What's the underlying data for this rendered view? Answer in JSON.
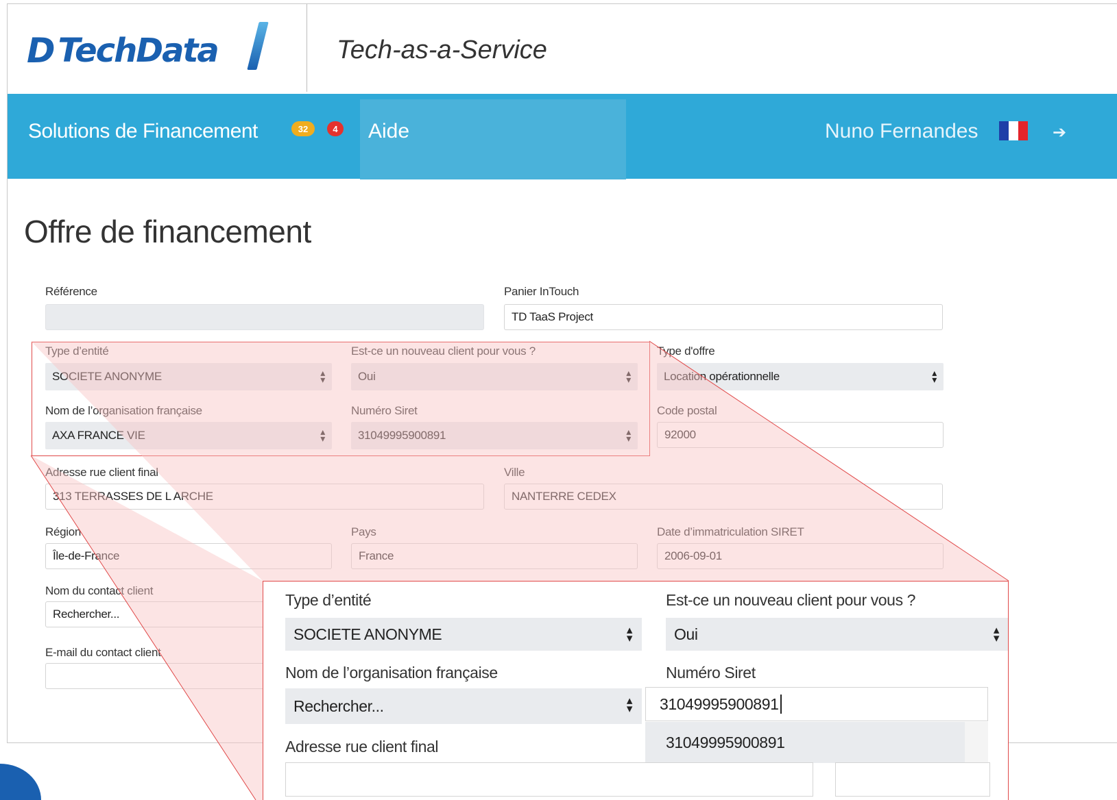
{
  "header": {
    "logo_mark": "D",
    "logo_text": "TechData",
    "app_title": "Tech-as-a-Service"
  },
  "nav": {
    "financing_label": "Solutions de Financement",
    "badge_orange": "32",
    "badge_red": "4",
    "help_label": "Aide",
    "user_name": "Nuno Fernandes",
    "flag_colors": [
      "#1f3fa8",
      "#ffffff",
      "#e3242b"
    ],
    "logout_icon": "logout-icon"
  },
  "page": {
    "title": "Offre de financement"
  },
  "form": {
    "reference": {
      "label": "Référence",
      "value": ""
    },
    "panier": {
      "label": "Panier InTouch",
      "value": "TD TaaS Project"
    },
    "type_entite": {
      "label": "Type d’entité",
      "value": "SOCIETE ANONYME"
    },
    "nouveau_client": {
      "label": "Est-ce un nouveau client pour vous ?",
      "value": "Oui"
    },
    "type_offre": {
      "label": "Type d'offre",
      "value": "Location opérationnelle"
    },
    "nom_org": {
      "label": "Nom de l’organisation française",
      "value": "AXA FRANCE VIE"
    },
    "siret": {
      "label": "Numéro Siret",
      "value": "31049995900891"
    },
    "code_postal": {
      "label": "Code postal",
      "value": "92000"
    },
    "adresse": {
      "label": "Adresse rue client final",
      "value": "313 TERRASSES DE L ARCHE"
    },
    "ville": {
      "label": "Ville",
      "value": "NANTERRE CEDEX"
    },
    "region": {
      "label": "Région",
      "value": "Île-de-France"
    },
    "pays": {
      "label": "Pays",
      "value": "France"
    },
    "date_siret": {
      "label": "Date d’immatriculation SIRET",
      "value": "2006-09-01"
    },
    "contact_nom": {
      "label": "Nom du contact client",
      "value": "Rechercher..."
    },
    "contact_email": {
      "label": "E-mail du contact client",
      "value": ""
    }
  },
  "zoom": {
    "type_entite_label": "Type d’entité",
    "type_entite_value": "SOCIETE ANONYME",
    "nouveau_client_label": "Est-ce un nouveau client pour vous ?",
    "nouveau_client_value": "Oui",
    "nom_org_label": "Nom de l’organisation française",
    "nom_org_value": "Rechercher...",
    "siret_label": "Numéro Siret",
    "siret_value": "31049995900891",
    "adresse_label": "Adresse rue client final",
    "dropdown_option": "31049995900891"
  },
  "colors": {
    "navbar": "#2fa9d8",
    "brand_blue": "#1a60b0",
    "highlight_red": "#e04848",
    "highlight_fill": "#fde4e4"
  }
}
